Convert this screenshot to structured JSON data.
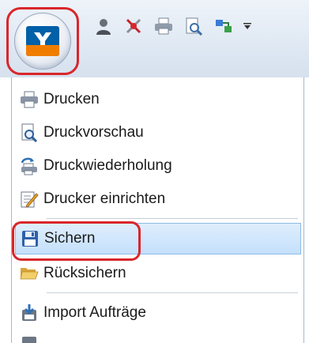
{
  "colors": {
    "annotation_red": "#d9262b",
    "brand_blue": "#0060a8",
    "brand_orange": "#f07d00",
    "selection": "#c4e0fb"
  },
  "quick_access": [
    {
      "icon": "user-icon"
    },
    {
      "icon": "tools-icon"
    },
    {
      "icon": "printer-icon"
    },
    {
      "icon": "print-preview-icon"
    },
    {
      "icon": "transfer-icon"
    },
    {
      "icon": "customize-dropdown-icon"
    }
  ],
  "menu": {
    "items": [
      {
        "label": "Drucken",
        "icon": "printer-icon"
      },
      {
        "label": "Druckvorschau",
        "icon": "magnifier-page-icon"
      },
      {
        "label": "Druckwiederholung",
        "icon": "reprint-icon"
      },
      {
        "label": "Drucker einrichten",
        "icon": "printer-setup-icon"
      },
      {
        "label": "Sichern",
        "icon": "floppy-disk-icon",
        "selected": true
      },
      {
        "label": "Rücksichern",
        "icon": "folder-open-icon"
      },
      {
        "label": "Import Aufträge",
        "icon": "import-icon"
      }
    ]
  }
}
